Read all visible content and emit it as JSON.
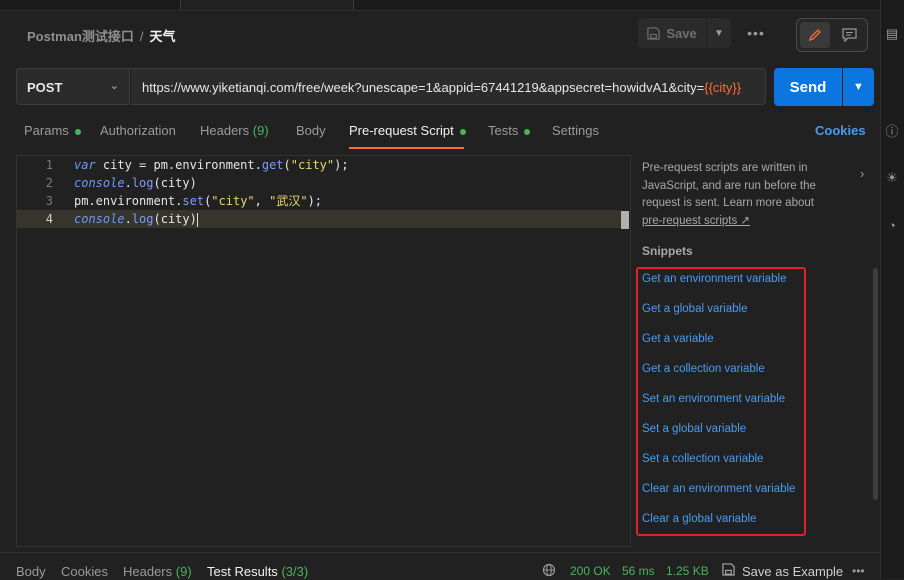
{
  "breadcrumb": {
    "parent": "Postman测试接口",
    "separator": "/",
    "current": "天气"
  },
  "toolbar": {
    "save_label": "Save",
    "more_label": "•••"
  },
  "request": {
    "method": "POST",
    "url_prefix": "https://www.yiketianqi.com/free/week?unescape=1&appid=67441219&appsecret=howidvA1&city=",
    "url_variable": "{{city}}",
    "send_label": "Send"
  },
  "tabs": [
    {
      "label": "Params",
      "count": "",
      "dot": true
    },
    {
      "label": "Authorization",
      "count": "",
      "dot": false
    },
    {
      "label": "Headers",
      "count": "(9)",
      "dot": false
    },
    {
      "label": "Body",
      "count": "",
      "dot": false
    },
    {
      "label": "Pre-request Script",
      "count": "",
      "dot": true
    },
    {
      "label": "Tests",
      "count": "",
      "dot": true
    },
    {
      "label": "Settings",
      "count": "",
      "dot": false
    }
  ],
  "cookies_label": "Cookies",
  "editor": {
    "line_numbers": [
      "1",
      "2",
      "3",
      "4"
    ],
    "line1": {
      "kw": "var",
      "a": " city = pm.environment.",
      "fn": "get",
      "b": "(",
      "str": "\"city\"",
      "c": ");"
    },
    "line2": {
      "kw": "console",
      "a": ".",
      "fn": "log",
      "b": "(city)"
    },
    "line3": {
      "a": "pm.environment.",
      "fn": "set",
      "b": "(",
      "str1": "\"city\"",
      "c": ", ",
      "str2": "\"武汉\"",
      "d": ");"
    },
    "line4": {
      "kw": "console",
      "a": ".",
      "fn": "log",
      "b": "(city)"
    }
  },
  "info": {
    "text": "Pre-request scripts are written in JavaScript, and are run before the request is sent. Learn more about",
    "link": "pre-request scripts ↗"
  },
  "snippets": {
    "title": "Snippets",
    "items": [
      "Get an environment variable",
      "Get a global variable",
      "Get a variable",
      "Get a collection variable",
      "Set an environment variable",
      "Set a global variable",
      "Set a collection variable",
      "Clear an environment variable",
      "Clear a global variable"
    ]
  },
  "response": {
    "tabs": [
      {
        "label": "Body",
        "count": ""
      },
      {
        "label": "Cookies",
        "count": ""
      },
      {
        "label": "Headers",
        "count": "(9)"
      },
      {
        "label": "Test Results",
        "count": "(3/3)"
      }
    ],
    "status": "200 OK",
    "time": "56 ms",
    "size": "1.25 KB",
    "save_example_label": "Save as Example",
    "more_label": "•••"
  },
  "colors": {
    "accent": "#ff6c37",
    "send": "#0b76e0",
    "link": "#4a9cf0",
    "ok": "#49b55b",
    "highlight": "#e3202b"
  },
  "icons": [
    "save-icon",
    "chevron-down-icon",
    "pencil-icon",
    "comment-icon",
    "chevron-right-icon",
    "globe-icon",
    "folder-icon",
    "docs-icon",
    "info-icon",
    "bulb-icon"
  ]
}
